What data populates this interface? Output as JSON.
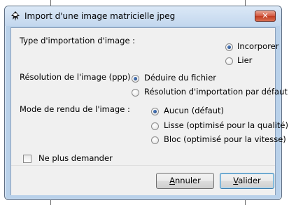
{
  "window": {
    "title": "Import d'une image matricielle jpeg",
    "close_label": "✕"
  },
  "import_type": {
    "label": "Type d'importation d'image :",
    "options": [
      {
        "label": "Incorporer",
        "selected": true
      },
      {
        "label": "Lier",
        "selected": false
      }
    ]
  },
  "resolution": {
    "label": "Résolution de l'image (ppp) :",
    "options": [
      {
        "label": "Déduire du fichier",
        "selected": true
      },
      {
        "label": "Résolution d'importation par défaut",
        "selected": false
      }
    ]
  },
  "render_mode": {
    "label": "Mode de rendu de l'image :",
    "options": [
      {
        "label": "Aucun (défaut)",
        "selected": true
      },
      {
        "label": "Lisse (optimisé pour la qualité)",
        "selected": false
      },
      {
        "label": "Bloc (optimisé pour la vitesse)",
        "selected": false
      }
    ]
  },
  "dont_ask": {
    "label": "Ne plus demander",
    "checked": false
  },
  "buttons": {
    "cancel": {
      "mnemonic": "A",
      "rest": "nnuler"
    },
    "ok": {
      "mnemonic": "V",
      "rest": "alider"
    }
  },
  "icons": {
    "title": "inkscape-icon",
    "close": "close-icon"
  }
}
